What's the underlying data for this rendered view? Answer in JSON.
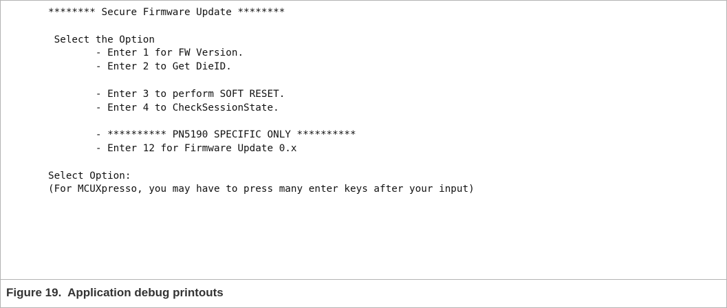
{
  "console": {
    "lines": [
      "******** Secure Firmware Update ********",
      "",
      " Select the Option",
      "        - Enter 1 for FW Version.",
      "        - Enter 2 to Get DieID.",
      "",
      "        - Enter 3 to perform SOFT RESET.",
      "        - Enter 4 to CheckSessionState.",
      "",
      "        - ********** PN5190 SPECIFIC ONLY **********",
      "        - Enter 12 for Firmware Update 0.x",
      "",
      "Select Option:",
      "(For MCUXpresso, you may have to press many enter keys after your input)"
    ]
  },
  "figure": {
    "caption": "Figure 19.  Application debug printouts"
  }
}
